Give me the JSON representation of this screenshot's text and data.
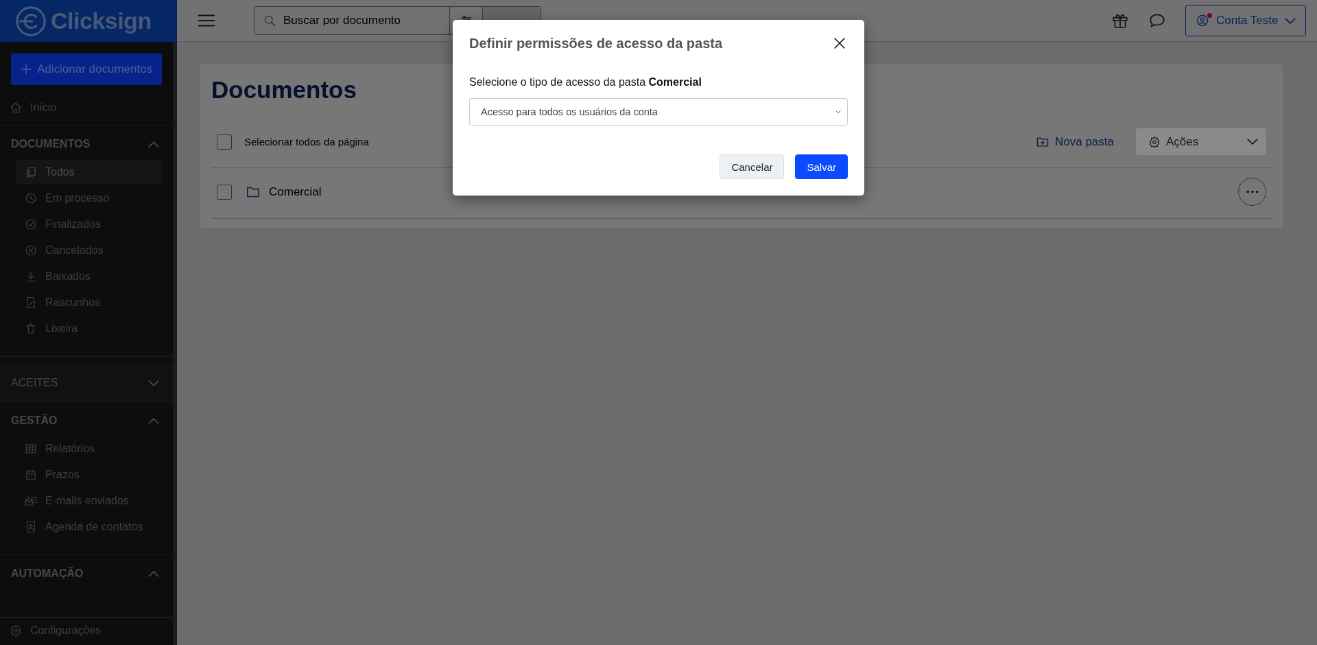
{
  "app": {
    "logo": "Clicksign"
  },
  "topbar": {
    "search": {
      "placeholder": "Buscar por documento"
    },
    "account": {
      "name": "Conta Teste",
      "notification": true
    }
  },
  "sidebar": {
    "add_button": "Adicionar documentos",
    "home": "Início",
    "sections": [
      {
        "title": "DOCUMENTOS",
        "expanded": true,
        "items": [
          {
            "label": "Todos",
            "selected": true
          },
          {
            "label": "Em processo",
            "selected": false
          },
          {
            "label": "Finalizados",
            "selected": false
          },
          {
            "label": "Cancelados",
            "selected": false
          },
          {
            "label": "Baixados",
            "selected": false
          },
          {
            "label": "Rascunhos",
            "selected": false
          },
          {
            "label": "Lixeira",
            "selected": false
          }
        ]
      },
      {
        "title": "ACEITES",
        "expanded": false
      },
      {
        "title": "GESTÃO",
        "expanded": true,
        "items": [
          {
            "label": "Relatórios",
            "selected": false
          },
          {
            "label": "Prazos",
            "selected": false
          },
          {
            "label": "E-mails enviados",
            "selected": false
          },
          {
            "label": "Agenda de contatos",
            "selected": false
          }
        ]
      },
      {
        "title": "AUTOMAÇÃO",
        "expanded": true
      }
    ],
    "settings": "Configurações"
  },
  "main": {
    "title": "Documentos",
    "select_all": {
      "label": "Selecionar todos da página",
      "checked": false
    },
    "new_folder": "Nova pasta",
    "actions": {
      "label": "Ações",
      "disabled": true
    },
    "folders": [
      {
        "name": "Comercial",
        "checked": false
      }
    ]
  },
  "modal": {
    "title": "Definir permissões de acesso da pasta",
    "prompt": "Selecione o tipo de acesso da pasta **Comercial**",
    "access_select": {
      "value": "Acesso para todos os usuários da conta"
    },
    "buttons": [
      {
        "label": "Cancelar",
        "kind": "secondary"
      },
      {
        "label": "Salvar",
        "kind": "primary"
      }
    ]
  }
}
